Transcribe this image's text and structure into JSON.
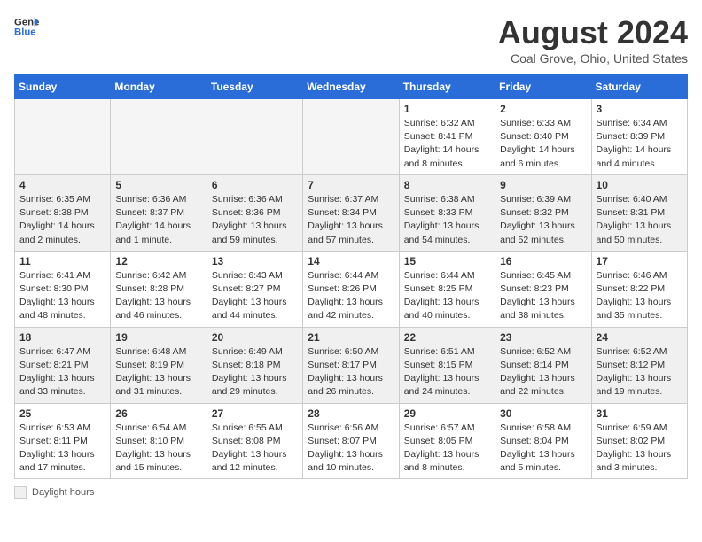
{
  "header": {
    "logo_line1": "General",
    "logo_line2": "Blue",
    "month_title": "August 2024",
    "location": "Coal Grove, Ohio, United States"
  },
  "days_of_week": [
    "Sunday",
    "Monday",
    "Tuesday",
    "Wednesday",
    "Thursday",
    "Friday",
    "Saturday"
  ],
  "footer": {
    "legend_label": "Daylight hours"
  },
  "weeks": [
    [
      {
        "day": "",
        "info": "",
        "empty": true
      },
      {
        "day": "",
        "info": "",
        "empty": true
      },
      {
        "day": "",
        "info": "",
        "empty": true
      },
      {
        "day": "",
        "info": "",
        "empty": true
      },
      {
        "day": "1",
        "info": "Sunrise: 6:32 AM\nSunset: 8:41 PM\nDaylight: 14 hours and 8 minutes."
      },
      {
        "day": "2",
        "info": "Sunrise: 6:33 AM\nSunset: 8:40 PM\nDaylight: 14 hours and 6 minutes."
      },
      {
        "day": "3",
        "info": "Sunrise: 6:34 AM\nSunset: 8:39 PM\nDaylight: 14 hours and 4 minutes."
      }
    ],
    [
      {
        "day": "4",
        "info": "Sunrise: 6:35 AM\nSunset: 8:38 PM\nDaylight: 14 hours and 2 minutes."
      },
      {
        "day": "5",
        "info": "Sunrise: 6:36 AM\nSunset: 8:37 PM\nDaylight: 14 hours and 1 minute."
      },
      {
        "day": "6",
        "info": "Sunrise: 6:36 AM\nSunset: 8:36 PM\nDaylight: 13 hours and 59 minutes."
      },
      {
        "day": "7",
        "info": "Sunrise: 6:37 AM\nSunset: 8:34 PM\nDaylight: 13 hours and 57 minutes."
      },
      {
        "day": "8",
        "info": "Sunrise: 6:38 AM\nSunset: 8:33 PM\nDaylight: 13 hours and 54 minutes."
      },
      {
        "day": "9",
        "info": "Sunrise: 6:39 AM\nSunset: 8:32 PM\nDaylight: 13 hours and 52 minutes."
      },
      {
        "day": "10",
        "info": "Sunrise: 6:40 AM\nSunset: 8:31 PM\nDaylight: 13 hours and 50 minutes."
      }
    ],
    [
      {
        "day": "11",
        "info": "Sunrise: 6:41 AM\nSunset: 8:30 PM\nDaylight: 13 hours and 48 minutes."
      },
      {
        "day": "12",
        "info": "Sunrise: 6:42 AM\nSunset: 8:28 PM\nDaylight: 13 hours and 46 minutes."
      },
      {
        "day": "13",
        "info": "Sunrise: 6:43 AM\nSunset: 8:27 PM\nDaylight: 13 hours and 44 minutes."
      },
      {
        "day": "14",
        "info": "Sunrise: 6:44 AM\nSunset: 8:26 PM\nDaylight: 13 hours and 42 minutes."
      },
      {
        "day": "15",
        "info": "Sunrise: 6:44 AM\nSunset: 8:25 PM\nDaylight: 13 hours and 40 minutes."
      },
      {
        "day": "16",
        "info": "Sunrise: 6:45 AM\nSunset: 8:23 PM\nDaylight: 13 hours and 38 minutes."
      },
      {
        "day": "17",
        "info": "Sunrise: 6:46 AM\nSunset: 8:22 PM\nDaylight: 13 hours and 35 minutes."
      }
    ],
    [
      {
        "day": "18",
        "info": "Sunrise: 6:47 AM\nSunset: 8:21 PM\nDaylight: 13 hours and 33 minutes."
      },
      {
        "day": "19",
        "info": "Sunrise: 6:48 AM\nSunset: 8:19 PM\nDaylight: 13 hours and 31 minutes."
      },
      {
        "day": "20",
        "info": "Sunrise: 6:49 AM\nSunset: 8:18 PM\nDaylight: 13 hours and 29 minutes."
      },
      {
        "day": "21",
        "info": "Sunrise: 6:50 AM\nSunset: 8:17 PM\nDaylight: 13 hours and 26 minutes."
      },
      {
        "day": "22",
        "info": "Sunrise: 6:51 AM\nSunset: 8:15 PM\nDaylight: 13 hours and 24 minutes."
      },
      {
        "day": "23",
        "info": "Sunrise: 6:52 AM\nSunset: 8:14 PM\nDaylight: 13 hours and 22 minutes."
      },
      {
        "day": "24",
        "info": "Sunrise: 6:52 AM\nSunset: 8:12 PM\nDaylight: 13 hours and 19 minutes."
      }
    ],
    [
      {
        "day": "25",
        "info": "Sunrise: 6:53 AM\nSunset: 8:11 PM\nDaylight: 13 hours and 17 minutes."
      },
      {
        "day": "26",
        "info": "Sunrise: 6:54 AM\nSunset: 8:10 PM\nDaylight: 13 hours and 15 minutes."
      },
      {
        "day": "27",
        "info": "Sunrise: 6:55 AM\nSunset: 8:08 PM\nDaylight: 13 hours and 12 minutes."
      },
      {
        "day": "28",
        "info": "Sunrise: 6:56 AM\nSunset: 8:07 PM\nDaylight: 13 hours and 10 minutes."
      },
      {
        "day": "29",
        "info": "Sunrise: 6:57 AM\nSunset: 8:05 PM\nDaylight: 13 hours and 8 minutes."
      },
      {
        "day": "30",
        "info": "Sunrise: 6:58 AM\nSunset: 8:04 PM\nDaylight: 13 hours and 5 minutes."
      },
      {
        "day": "31",
        "info": "Sunrise: 6:59 AM\nSunset: 8:02 PM\nDaylight: 13 hours and 3 minutes."
      }
    ]
  ]
}
